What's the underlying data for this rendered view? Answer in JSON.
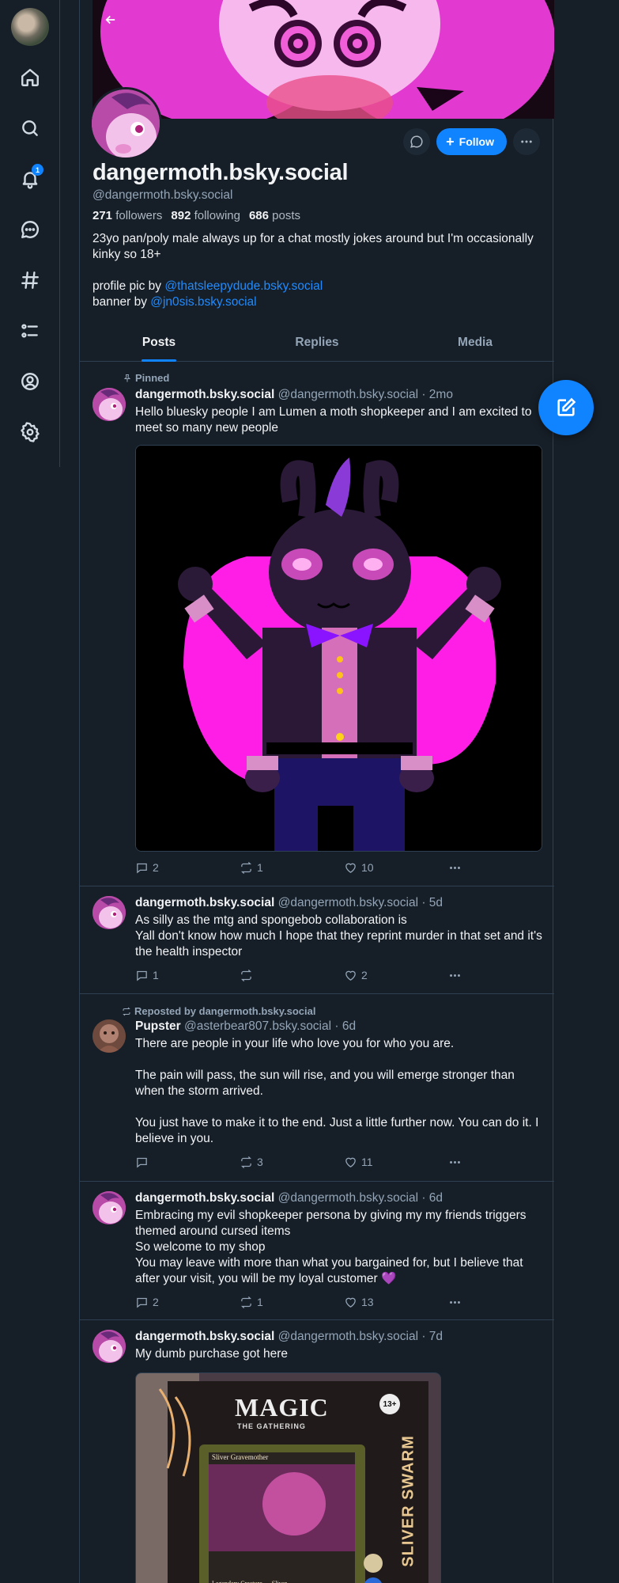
{
  "nav": {
    "items": [
      {
        "name": "home-icon"
      },
      {
        "name": "search-icon"
      },
      {
        "name": "bell-icon",
        "badge": "1"
      },
      {
        "name": "chat-icon"
      },
      {
        "name": "hashtag-icon"
      },
      {
        "name": "list-icon"
      },
      {
        "name": "profile-icon"
      },
      {
        "name": "gear-icon"
      }
    ]
  },
  "profile": {
    "display_name": "dangermoth.bsky.social",
    "handle": "@dangermoth.bsky.social",
    "followers_count": "271",
    "followers_label": "followers",
    "following_count": "892",
    "following_label": "following",
    "posts_count": "686",
    "posts_label": "posts",
    "bio_line1": "23yo pan/poly male always up for a chat mostly jokes around but I'm occasionally kinky so 18+",
    "bio_pic_prefix": "profile pic by ",
    "bio_pic_link": "@thatsleepydude.bsky.social",
    "bio_banner_prefix": "banner by ",
    "bio_banner_link": "@jn0sis.bsky.social",
    "follow_label": "Follow"
  },
  "tabs": [
    "Posts",
    "Replies",
    "Media"
  ],
  "posts": [
    {
      "context": "Pinned",
      "name": "dangermoth.bsky.social",
      "handle": "@dangermoth.bsky.social · 2mo",
      "text": "Hello bluesky people I am Lumen a moth shopkeeper and I am excited to meet so many new people",
      "replies": "2",
      "reposts": "1",
      "likes": "10"
    },
    {
      "name": "dangermoth.bsky.social",
      "handle": "@dangermoth.bsky.social · 5d",
      "text": "As silly as the mtg and spongebob collaboration is\nYall don't know how much I hope that they reprint murder in that set and it's the health inspector",
      "replies": "1",
      "reposts": "",
      "likes": "2"
    },
    {
      "context": "Reposted by dangermoth.bsky.social",
      "name": "Pupster",
      "handle": "@asterbear807.bsky.social · 6d",
      "text": "There are people in your life who love you for who you are.\n\nThe pain will pass, the sun will rise, and you will emerge stronger than when the storm arrived.\n\nYou just have to make it to the end. Just a little further now. You can do it. I believe in you.",
      "replies": "",
      "reposts": "3",
      "likes": "11"
    },
    {
      "name": "dangermoth.bsky.social",
      "handle": "@dangermoth.bsky.social · 6d",
      "text": "Embracing my evil shopkeeper persona by giving my my friends triggers themed around cursed items\nSo welcome to my shop\nYou may leave with more than what you bargained for, but I believe that after your visit, you will be my loyal customer 💜",
      "replies": "2",
      "reposts": "1",
      "likes": "13"
    },
    {
      "name": "dangermoth.bsky.social",
      "handle": "@dangermoth.bsky.social · 7d",
      "text": "My dumb purchase got here",
      "card_logo": "MAGIC",
      "card_sub": "THE GATHERING",
      "card_deck": "SLIVER SWARM",
      "card_rating": "13+",
      "card_name": "Sliver Gravemother",
      "card_type": "Legendary Creature — Sliver"
    }
  ]
}
